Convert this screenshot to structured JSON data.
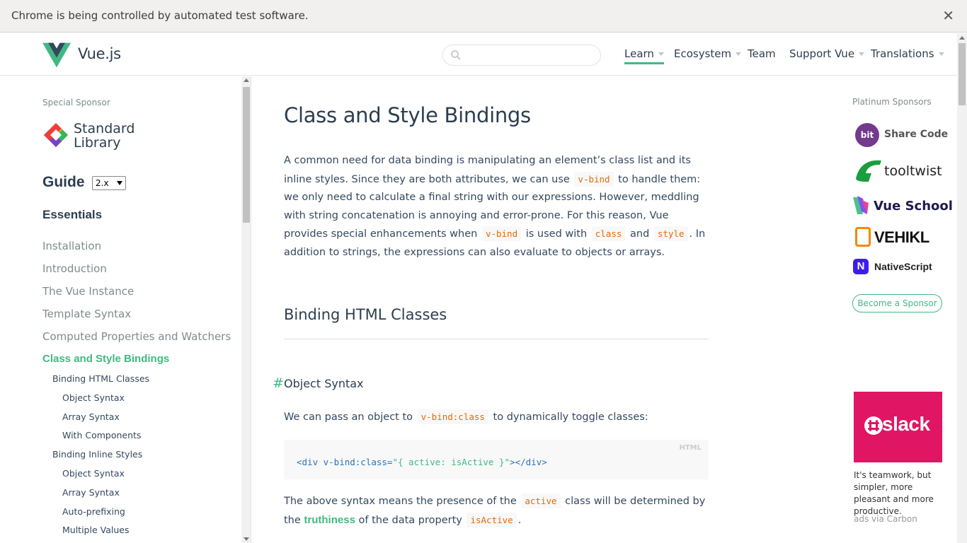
{
  "infobar": {
    "message": "Chrome is being controlled by automated test software.",
    "close_glyph": "✕"
  },
  "header": {
    "brand": "Vue.js",
    "search_value": "",
    "nav": [
      {
        "label": "Learn",
        "dropdown": true,
        "active": true
      },
      {
        "label": "Ecosystem",
        "dropdown": true
      },
      {
        "label": "Team",
        "dropdown": false
      },
      {
        "label": "Support Vue",
        "dropdown": true
      },
      {
        "label": "Translations",
        "dropdown": true
      }
    ]
  },
  "sidebar": {
    "special_sponsor_label": "Special Sponsor",
    "special_sponsor_name": [
      "Standard",
      "Library"
    ],
    "guide_title": "Guide",
    "version": "2.x",
    "section_title": "Essentials",
    "links": [
      {
        "label": "Installation"
      },
      {
        "label": "Introduction"
      },
      {
        "label": "The Vue Instance"
      },
      {
        "label": "Template Syntax"
      },
      {
        "label": "Computed Properties and Watchers"
      },
      {
        "label": "Class and Style Bindings",
        "current": true
      }
    ],
    "sub_links": [
      {
        "label": "Binding HTML Classes",
        "level": 1
      },
      {
        "label": "Object Syntax",
        "level": 2
      },
      {
        "label": "Array Syntax",
        "level": 2
      },
      {
        "label": "With Components",
        "level": 2
      },
      {
        "label": "Binding Inline Styles",
        "level": 1
      },
      {
        "label": "Object Syntax",
        "level": 2
      },
      {
        "label": "Array Syntax",
        "level": 2
      },
      {
        "label": "Auto-prefixing",
        "level": 2
      },
      {
        "label": "Multiple Values",
        "level": 2
      }
    ]
  },
  "content": {
    "title": "Class and Style Bindings",
    "intro": {
      "t1": "A common need for data binding is manipulating an element’s class list and its inline styles. Since they are both attributes, we can use ",
      "c1": "v-bind",
      "t2": " to handle them: we only need to calculate a final string with our expressions. However, meddling with string concatenation is annoying and error-prone. For this reason, Vue provides special enhancements when ",
      "c2": "v-bind",
      "t3": " is used with ",
      "c3": "class",
      "t4": " and ",
      "c4": "style",
      "t5": ". In addition to strings, the expressions can also evaluate to objects or arrays."
    },
    "section_title": "Binding HTML Classes",
    "anchor": "#",
    "subsection_title": "Object Syntax",
    "p1": {
      "t1": "We can pass an object to ",
      "c1": "v-bind:class",
      "t2": " to dynamically toggle classes:"
    },
    "code": {
      "lang": "HTML",
      "pre": "<div v-bind:class=",
      "str": "\"{ active: isActive }\"",
      "post": "></div>"
    },
    "p2": {
      "t1": "The above syntax means the presence of the ",
      "c1": "active",
      "t2": " class will be determined by the ",
      "link": "truthiness",
      "t3": " of the data property ",
      "c2": "isActive",
      "t4": "."
    }
  },
  "right": {
    "platinum_label": "Platinum Sponsors",
    "sponsors": [
      "Share Code",
      "tooltwist",
      "Vue School",
      "VEHIKL",
      "NativeScript"
    ],
    "bit_badge": "bit",
    "become_label": "Become a Sponsor",
    "carbon_brand": "slack",
    "carbon_text": "It's teamwork, but simpler, more pleasant and more productive.",
    "carbon_via": "ads via Carbon"
  },
  "colors": {
    "accent": "#42b983",
    "text": "#2c3e50",
    "code": "#e96900",
    "slack": "#e01563"
  }
}
